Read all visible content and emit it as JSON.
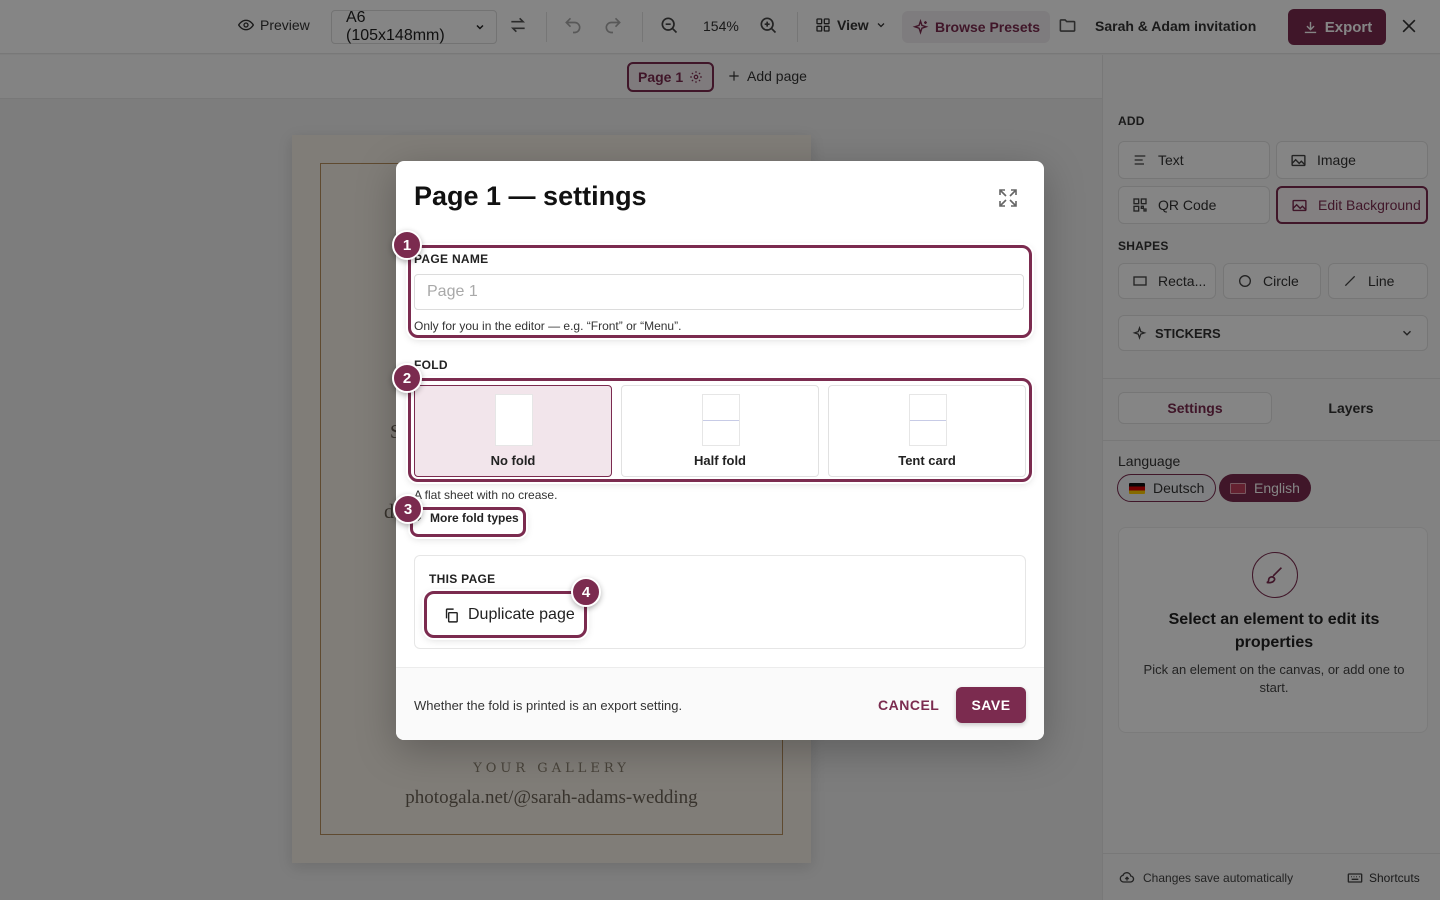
{
  "topbar": {
    "preview_label": "Preview",
    "page_size": "A6 (105x148mm)",
    "zoom": "154%",
    "view_label": "View",
    "presets_label": "Browse Presets",
    "project_title": "Sarah & Adam invitation",
    "export_label": "Export"
  },
  "pagebar": {
    "current_page": "Page 1",
    "add_page_label": "Add page"
  },
  "canvas": {
    "gallery_text": "YOUR GALLERY",
    "url_text": "photogala.net/@sarah-adams-wedding"
  },
  "sidebar": {
    "add_heading": "ADD",
    "add_items": [
      "Text",
      "Image",
      "QR Code",
      "Edit Background"
    ],
    "shapes_heading": "SHAPES",
    "shape_items": [
      "Recta...",
      "Circle",
      "Line"
    ],
    "stickers_label": "STICKERS",
    "tabs": [
      "Settings",
      "Layers"
    ],
    "language_label": "Language",
    "languages": [
      "Deutsch",
      "English"
    ],
    "selected_language": "English",
    "empty_title": "Select an element to edit its properties",
    "empty_subtitle": "Pick an element on the canvas, or add one to start.",
    "autosave_text": "Changes save automatically",
    "shortcuts_label": "Shortcuts"
  },
  "modal": {
    "title": "Page 1 — settings",
    "page_name_label": "PAGE NAME",
    "page_name_placeholder": "Page 1",
    "page_name_value": "",
    "page_name_help": "Only for you in the editor — e.g. “Front” or “Menu”.",
    "fold_label": "FOLD",
    "fold_options": [
      "No fold",
      "Half fold",
      "Tent card"
    ],
    "fold_selected": "No fold",
    "fold_help": "A flat sheet with no crease.",
    "more_fold_label": "More fold types",
    "this_page_label": "THIS PAGE",
    "duplicate_label": "Duplicate page",
    "footer_note": "Whether the fold is printed is an export setting.",
    "cancel_label": "CANCEL",
    "save_label": "SAVE"
  },
  "tour": {
    "steps": [
      "1",
      "2",
      "3",
      "4"
    ]
  },
  "colors": {
    "accent": "#7b2b4f",
    "accent_light": "#f2e5eb",
    "overlay": "rgba(0,0,0,0.48)"
  }
}
